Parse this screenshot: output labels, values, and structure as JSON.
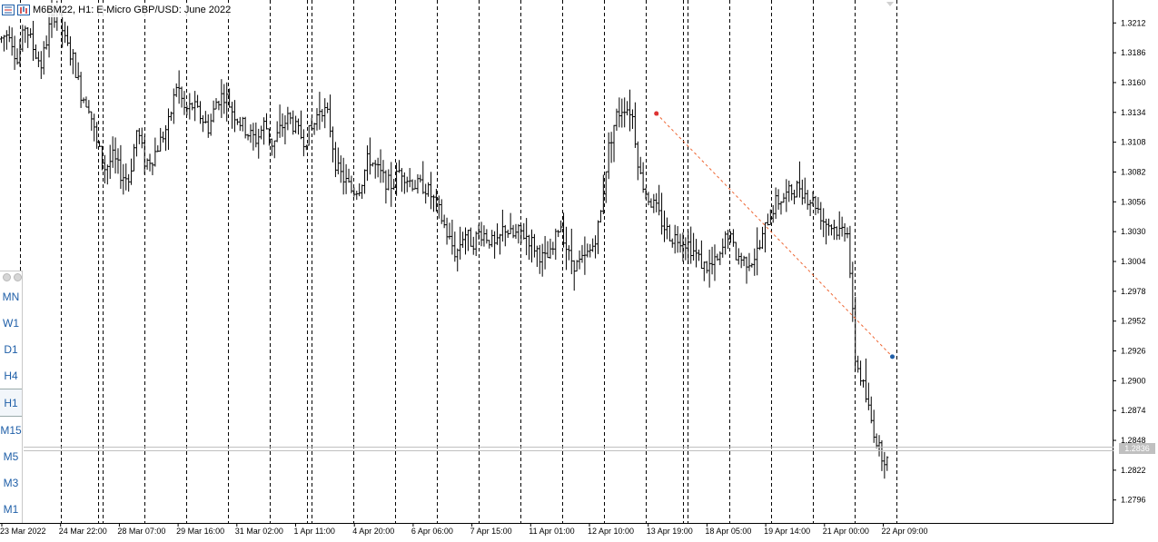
{
  "window": {
    "title": "M6BM22, H1:  E-Micro GBP/USD: June 2022"
  },
  "timeframes": {
    "items": [
      "MN",
      "W1",
      "D1",
      "H4",
      "H1",
      "M15",
      "M5",
      "M3",
      "M1"
    ],
    "active": "H1"
  },
  "current_price_label": "1.2836",
  "chart_data": {
    "type": "bar",
    "title": "M6BM22, H1:  E-Micro GBP/USD: June 2022",
    "style": "ohlc-bars",
    "ylim": [
      1.2776,
      1.3232
    ],
    "y_ticks": [
      "1.3212",
      "1.3186",
      "1.3160",
      "1.3134",
      "1.3108",
      "1.3082",
      "1.3056",
      "1.3030",
      "1.3004",
      "1.2978",
      "1.2952",
      "1.2926",
      "1.2900",
      "1.2874",
      "1.2848",
      "1.2822",
      "1.2796"
    ],
    "x_ticks": [
      "23 Mar 2022",
      "24 Mar 22:00",
      "28 Mar 07:00",
      "29 Mar 16:00",
      "31 Mar 02:00",
      "1 Apr 11:00",
      "4 Apr 20:00",
      "6 Apr 06:00",
      "7 Apr 15:00",
      "11 Apr 01:00",
      "12 Apr 10:00",
      "13 Apr 19:00",
      "18 Apr 05:00",
      "19 Apr 14:00",
      "21 Apr 00:00",
      "22 Apr 09:00"
    ],
    "grid": "vertical-dashed",
    "current_price": 1.2836,
    "price_path": [
      1.3198,
      1.3205,
      1.3178,
      1.321,
      1.319,
      1.3175,
      1.3208,
      1.3226,
      1.3195,
      1.318,
      1.315,
      1.314,
      1.3105,
      1.3085,
      1.3095,
      1.308,
      1.3075,
      1.312,
      1.309,
      1.3095,
      1.311,
      1.3125,
      1.316,
      1.3135,
      1.314,
      1.313,
      1.312,
      1.3145,
      1.315,
      1.3135,
      1.3125,
      1.3115,
      1.311,
      1.3125,
      1.3105,
      1.312,
      1.313,
      1.3118,
      1.311,
      1.312,
      1.314,
      1.313,
      1.3085,
      1.3075,
      1.3065,
      1.307,
      1.3095,
      1.3085,
      1.3075,
      1.307,
      1.3085,
      1.3075,
      1.307,
      1.307,
      1.306,
      1.3045,
      1.3025,
      1.301,
      1.303,
      1.302,
      1.303,
      1.3025,
      1.3015,
      1.3035,
      1.3025,
      1.303,
      1.3025,
      1.3015,
      1.3005,
      1.301,
      1.304,
      1.301,
      1.3,
      1.3005,
      1.3015,
      1.304,
      1.31,
      1.313,
      1.314,
      1.3135,
      1.308,
      1.306,
      1.305,
      1.3035,
      1.3025,
      1.3025,
      1.302,
      1.301,
      1.3,
      1.3,
      1.3005,
      1.303,
      1.301,
      1.3005,
      1.3005,
      1.3015,
      1.304,
      1.3055,
      1.306,
      1.3065,
      1.307,
      1.306,
      1.3055,
      1.304,
      1.3035,
      1.303,
      1.3035,
      1.292,
      1.2895,
      1.2865,
      1.284,
      1.283
    ],
    "annotations": [
      {
        "type": "dashed-line",
        "color": "#ee6633",
        "from": {
          "x": "13 Apr 19:00",
          "y": 1.3133
        },
        "to": {
          "x": "22 Apr 09:00",
          "y": 1.2921
        }
      },
      {
        "type": "marker",
        "color": "#dd3333",
        "x": "13 Apr 19:00",
        "y": 1.3133
      },
      {
        "type": "marker",
        "color": "#1f5fa8",
        "x": "22 Apr 09:00",
        "y": 1.2921
      }
    ]
  }
}
